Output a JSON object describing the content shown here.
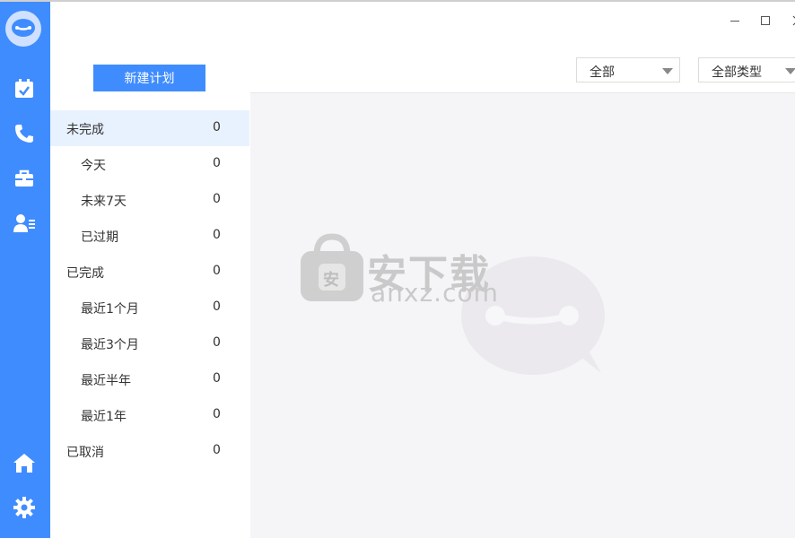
{
  "window": {
    "minimize_icon": "minimize-icon",
    "maximize_icon": "maximize-icon",
    "close_icon": "close-icon"
  },
  "rail": {
    "accent": "#3f8cff",
    "items": [
      {
        "icon": "calendar-check-icon"
      },
      {
        "icon": "phone-icon"
      },
      {
        "icon": "briefcase-icon"
      },
      {
        "icon": "contact-list-icon"
      }
    ],
    "bottom": [
      {
        "icon": "home-icon"
      },
      {
        "icon": "settings-gear-icon"
      }
    ]
  },
  "sidebar": {
    "new_plan_label": "新建计划",
    "groups": [
      {
        "label": "未完成",
        "count": "0",
        "active": true
      },
      {
        "label": "今天",
        "count": "0"
      },
      {
        "label": "未来7天",
        "count": "0"
      },
      {
        "label": "已过期",
        "count": "0"
      },
      {
        "label": "已完成",
        "count": "0"
      },
      {
        "label": "最近1个月",
        "count": "0"
      },
      {
        "label": "最近3个月",
        "count": "0"
      },
      {
        "label": "最近半年",
        "count": "0"
      },
      {
        "label": "最近1年",
        "count": "0"
      },
      {
        "label": "已取消",
        "count": "0"
      }
    ]
  },
  "filters": {
    "scope": {
      "value": "全部"
    },
    "type": {
      "value": "全部类型"
    }
  },
  "watermark": {
    "title": "安下载",
    "url": "anxz.com",
    "badge": "安"
  }
}
